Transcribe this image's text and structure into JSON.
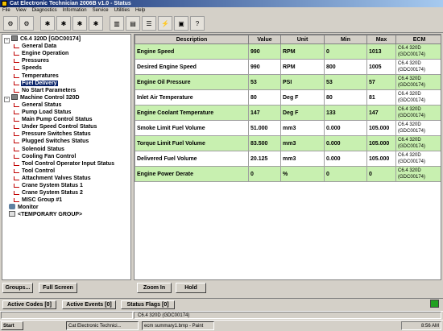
{
  "window": {
    "title": "Cat Electronic Technician 2006B v1.0 - Status"
  },
  "menu": [
    "File",
    "View",
    "Diagnostics",
    "Information",
    "Service",
    "Utilities",
    "Help"
  ],
  "tree": {
    "ecm1": "C6.4 320D [GDC00174]",
    "ecm1_children": [
      "General Data",
      "Engine Operation",
      "Pressures",
      "Speeds",
      "Temperatures",
      "Fuel Delivery",
      "No Start Parameters"
    ],
    "ecm2": "Machine Control 320D",
    "ecm2_children": [
      "General Status",
      "Pump Load Status",
      "Main Pump Control Status",
      "Under Speed Control Status",
      "Pressure Switches Status",
      "Plugged Switches Status",
      "Solenoid Status",
      "Cooling Fan Control",
      "Tool Control Operator Input Status",
      "Tool Control",
      "Attachment Valves Status",
      "Crane System Status 1",
      "Crane System Status 2",
      "MISC Group #1"
    ],
    "monitor": "Monitor",
    "temp_group": "<TEMPORARY GROUP>",
    "selected": "Fuel Delivery"
  },
  "table": {
    "columns": [
      "Description",
      "Value",
      "Unit",
      "Min",
      "Max",
      "ECM"
    ],
    "rows": [
      {
        "desc": "Engine Speed",
        "value": "990",
        "unit": "RPM",
        "min": "0",
        "max": "1013",
        "ecm": "C6.4 320D (GDC00174)",
        "hl": true
      },
      {
        "desc": "Desired Engine Speed",
        "value": "990",
        "unit": "RPM",
        "min": "800",
        "max": "1005",
        "ecm": "C6.4 320D (GDC00174)",
        "hl": false
      },
      {
        "desc": "Engine Oil Pressure",
        "value": "53",
        "unit": "PSI",
        "min": "53",
        "max": "57",
        "ecm": "C6.4 320D (GDC00174)",
        "hl": true
      },
      {
        "desc": "Inlet Air Temperature",
        "value": "80",
        "unit": "Deg F",
        "min": "80",
        "max": "81",
        "ecm": "C6.4 320D (GDC00174)",
        "hl": false
      },
      {
        "desc": "Engine Coolant Temperature",
        "value": "147",
        "unit": "Deg F",
        "min": "133",
        "max": "147",
        "ecm": "C6.4 320D (GDC00174)",
        "hl": true
      },
      {
        "desc": "Smoke Limit Fuel Volume",
        "value": "51.000",
        "unit": "mm3",
        "min": "0.000",
        "max": "105.000",
        "ecm": "C6.4 320D (GDC00174)",
        "hl": false
      },
      {
        "desc": "Torque Limit Fuel Volume",
        "value": "83.500",
        "unit": "mm3",
        "min": "0.000",
        "max": "105.000",
        "ecm": "C6.4 320D (GDC00174)",
        "hl": true
      },
      {
        "desc": "Delivered Fuel Volume",
        "value": "20.125",
        "unit": "mm3",
        "min": "0.000",
        "max": "105.000",
        "ecm": "C6.4 320D (GDC00174)",
        "hl": false
      },
      {
        "desc": "Engine Power Derate",
        "value": "0",
        "unit": "%",
        "min": "0",
        "max": "0",
        "ecm": "C6.4 320D (GDC00174)",
        "hl": true
      }
    ]
  },
  "buttons": {
    "groups": "Groups...",
    "full_screen": "Full Screen",
    "zoom_in": "Zoom In",
    "hold": "Hold"
  },
  "codes": {
    "active_codes": "Active Codes [0]",
    "active_events": "Active Events [0]",
    "status_flags": "Status Flags [0]"
  },
  "statusbar": {
    "ecm": "C6.4 320D (GDC00174)"
  },
  "taskbar": {
    "start": "Start",
    "task1": "Cat Electronic Technici...",
    "task2": "ecm summary1.bmp - Paint",
    "clock": "8:56 AM"
  },
  "colors": {
    "highlight_row": "#c8f0b0",
    "selection": "#0a246a",
    "title_gradient_start": "#0a246a"
  }
}
